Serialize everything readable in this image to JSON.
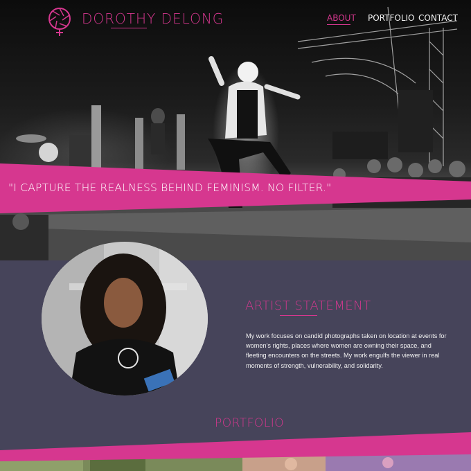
{
  "brand": {
    "name": "DOROTHY DELONG",
    "logo_icon": "camera-aperture-venus-icon",
    "accent_color": "#d6378f"
  },
  "nav": {
    "items": [
      {
        "label": "ABOUT",
        "active": true
      },
      {
        "label": "PORTFOLIO",
        "active": false
      },
      {
        "label": "CONTACT",
        "active": false
      }
    ]
  },
  "hero": {
    "quote": "\"I CAPTURE THE REALNESS BEHIND FEMINISM. NO FILTER.\"",
    "image_description": "black and white concert photo of singer jumping on stage"
  },
  "statement": {
    "title": "ARTIST STATEMENT",
    "body": "My work focuses on candid photographs taken on location at events for women's rights, places where women are owning their space, and fleeting encounters on the streets. My work engulfs the viewer in real moments of strength, vulnerability, and solidarity.",
    "background_color": "#46445a"
  },
  "portfolio": {
    "heading": "PORTFOLIO"
  }
}
